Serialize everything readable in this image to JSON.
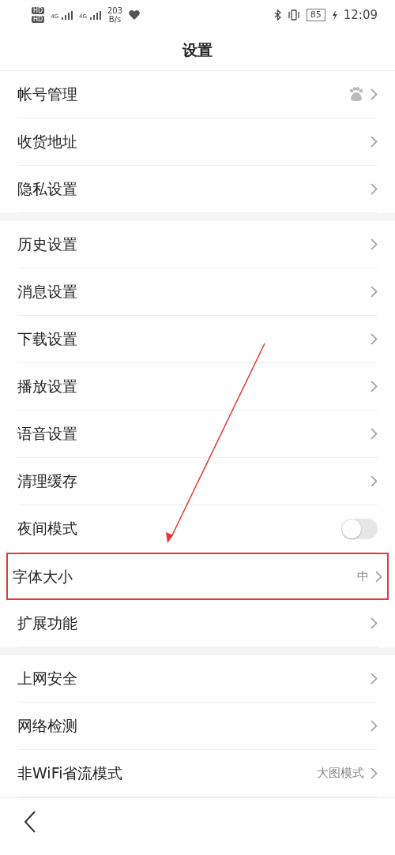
{
  "status_bar": {
    "hd_labels": [
      "HD",
      "HD"
    ],
    "network_labels": [
      "4G",
      "4G"
    ],
    "speed": "203",
    "speed_unit": "B/s",
    "battery": "85",
    "time": "12:09"
  },
  "title": "设置",
  "sections": [
    [
      {
        "label": "帐号管理",
        "kind": "account"
      },
      {
        "label": "收货地址",
        "kind": "link"
      },
      {
        "label": "隐私设置",
        "kind": "link"
      }
    ],
    [
      {
        "label": "历史设置",
        "kind": "link"
      },
      {
        "label": "消息设置",
        "kind": "link"
      },
      {
        "label": "下载设置",
        "kind": "link"
      },
      {
        "label": "播放设置",
        "kind": "link"
      },
      {
        "label": "语音设置",
        "kind": "link"
      },
      {
        "label": "清理缓存",
        "kind": "link"
      },
      {
        "label": "夜间模式",
        "kind": "toggle",
        "on": false
      },
      {
        "label": "字体大小",
        "kind": "link",
        "value": "中",
        "highlighted": true
      },
      {
        "label": "扩展功能",
        "kind": "link"
      }
    ],
    [
      {
        "label": "上网安全",
        "kind": "link"
      },
      {
        "label": "网络检测",
        "kind": "link"
      },
      {
        "label": "非WiFi省流模式",
        "kind": "link",
        "value": "大图模式"
      }
    ]
  ]
}
